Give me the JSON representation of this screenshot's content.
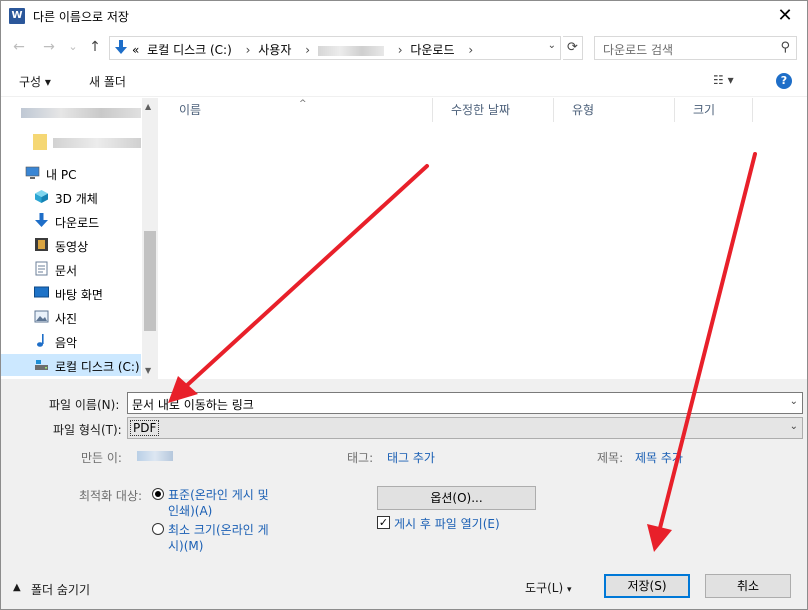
{
  "window": {
    "title": "다른 이름으로 저장",
    "app_icon_letter": "W",
    "close_glyph": "✕"
  },
  "nav": {
    "back": "←",
    "forward": "→",
    "recent": "⌄",
    "up": "↑",
    "address": {
      "overflow": "«",
      "crumbs": [
        "로컬 디스크 (C:)",
        "사용자",
        "다운로드"
      ],
      "separator": "›"
    },
    "search_placeholder": "다운로드 검색"
  },
  "toolbar": {
    "organize": "구성 ▾",
    "new_folder": "새 폴더",
    "view_glyph": "☷ ▾",
    "help": "?"
  },
  "navpane": {
    "items": [
      {
        "label": "내 PC",
        "icon": "pc-icon"
      },
      {
        "label": "3D 개체",
        "icon": "3d-objects-icon"
      },
      {
        "label": "다운로드",
        "icon": "download-icon"
      },
      {
        "label": "동영상",
        "icon": "video-icon"
      },
      {
        "label": "문서",
        "icon": "document-icon"
      },
      {
        "label": "바탕 화면",
        "icon": "desktop-icon"
      },
      {
        "label": "사진",
        "icon": "pictures-icon"
      },
      {
        "label": "음악",
        "icon": "music-icon"
      },
      {
        "label": "로컬 디스크 (C:)",
        "icon": "drive-icon"
      }
    ]
  },
  "filelist": {
    "columns": [
      "이름",
      "수정한 날짜",
      "유형",
      "크기"
    ]
  },
  "form": {
    "filename_label": "파일 이름(N):",
    "filename_value": "문서 내로 이동하는 링크",
    "filetype_label": "파일 형식(T):",
    "filetype_value": "PDF",
    "author_label": "만든 이:",
    "tags_label": "태그:",
    "tags_value": "태그 추가",
    "title_label": "제목:",
    "title_value": "제목 추가",
    "optimize_label": "최적화 대상:",
    "opt_standard_line1": "표준(온라인 게시 및",
    "opt_standard_line2": "인쇄)(A)",
    "opt_min_line1": "최소 크기(온라인 게",
    "opt_min_line2": "시)(M)",
    "options_button": "옵션(O)...",
    "open_after_publish": "게시 후 파일 열기(E)"
  },
  "footer": {
    "hide_folders": "폴더 숨기기",
    "tools": "도구(L)",
    "save": "저장(S)",
    "cancel": "취소"
  },
  "colors": {
    "annotation_arrow": "#e8202a",
    "selection": "#cce8ff",
    "link": "#1a5fb4"
  }
}
